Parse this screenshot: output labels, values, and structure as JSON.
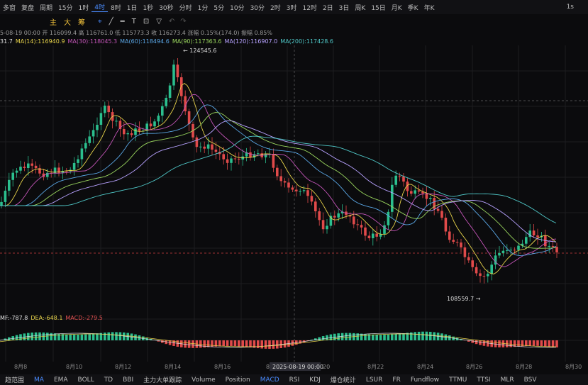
{
  "topbar": {
    "items": [
      "多窗",
      "复盘",
      "周期",
      "15分",
      "1时",
      "4时",
      "8时",
      "1日",
      "1秒",
      "30秒",
      "分时",
      "1分",
      "5分",
      "10分",
      "30分",
      "2时",
      "3时",
      "12时",
      "2日",
      "3日",
      "周K",
      "15日",
      "月K",
      "季K",
      "年K"
    ],
    "selected": "4时",
    "right": "1s"
  },
  "toolbar": {
    "chars": [
      "主",
      "大",
      "筹"
    ]
  },
  "ohlc": "5-08-19 00:00  开 116099.4  高 116761.0  低 115773.3  收 116273.4  涨幅 0.15%(174.0)  振幅 0.85%",
  "ma_labels": [
    {
      "text": "31.7",
      "color": "#e0e0e0"
    },
    {
      "text": "MA(14):116940.9",
      "color": "#e6d24a"
    },
    {
      "text": "MA(30):118045.3",
      "color": "#c455b8"
    },
    {
      "text": "MA(60):118494.6",
      "color": "#5aa7e6"
    },
    {
      "text": "MA(90):117363.6",
      "color": "#9ad65e"
    },
    {
      "text": "MA(120):116907.0",
      "color": "#b7a2ff"
    },
    {
      "text": "MA(200):117428.6",
      "color": "#4fc7c7"
    }
  ],
  "annotations": {
    "high": "124545.6",
    "low": "108559.7"
  },
  "macd_labels": [
    {
      "text": "MF:-787.8",
      "color": "#e0e0e0"
    },
    {
      "text": "DEA:-648.1",
      "color": "#e6d24a"
    },
    {
      "text": "MACD:-279.5",
      "color": "#e05050"
    }
  ],
  "date_axis": [
    "8月8",
    "8月10",
    "8月12",
    "8月14",
    "8月16",
    "8月18",
    "20",
    "8月22",
    "8月24",
    "8月26",
    "8月28",
    "8月30"
  ],
  "cursor_date": "2025-08-19 00:00",
  "bottombar": {
    "items": [
      "趋范围",
      "MA",
      "EMA",
      "BOLL",
      "TD",
      "BBI",
      "主力大单跟踪",
      "Volume",
      "Position",
      "MACD",
      "RSI",
      "KDJ",
      "爆仓统计",
      "LSUR",
      "FR",
      "Fundflow",
      "TTMU",
      "TTSI",
      "MLR",
      "BSV"
    ],
    "selected": [
      "MA",
      "MACD"
    ]
  },
  "colors": {
    "up": "#2bbf8e",
    "down": "#e04a4a",
    "grid": "#1c1c20",
    "bg": "#0b0b0d",
    "accent": "#4a8cff"
  }
}
